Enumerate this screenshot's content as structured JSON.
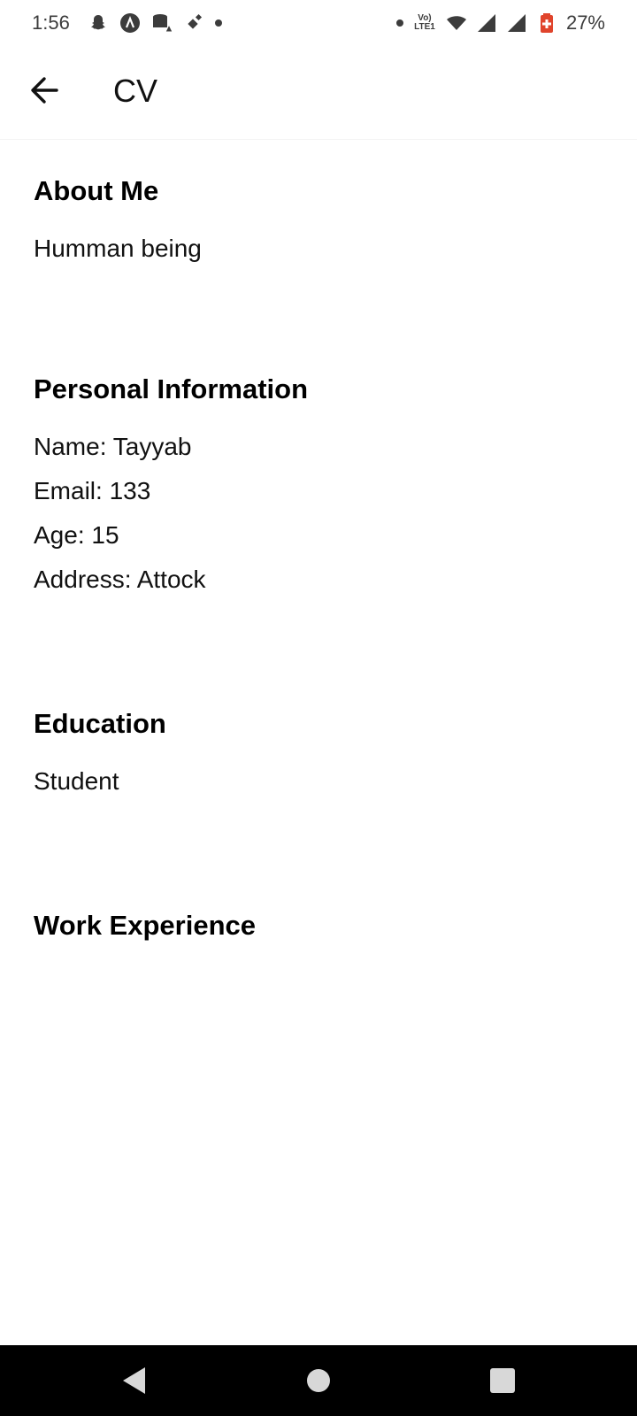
{
  "status_bar": {
    "time": "1:56",
    "volte_line1": "Vo)",
    "volte_line2": "LTE1",
    "battery_percent": "27%",
    "icons": [
      "snapchat-icon",
      "notification-app-icon",
      "database-warning-icon",
      "satellite-icon",
      "notification-dot",
      "notification-dot",
      "volte-icon",
      "wifi-icon",
      "signal-icon",
      "signal-icon",
      "battery-icon"
    ],
    "battery_color": "#e0442c"
  },
  "app_bar": {
    "title": "CV",
    "back_icon": "arrow-left-icon"
  },
  "sections": {
    "about": {
      "heading": "About Me",
      "text": "Humman being"
    },
    "personal": {
      "heading": "Personal Information",
      "name": "Name: Tayyab",
      "email": "Email: 133",
      "age": "Age: 15",
      "address": "Address: Attock"
    },
    "education": {
      "heading": "Education",
      "text": "Student"
    },
    "work": {
      "heading": "Work Experience"
    }
  },
  "nav_bar": {
    "back_icon": "triangle-back-icon",
    "home_icon": "circle-home-icon",
    "recents_icon": "square-recents-icon"
  }
}
